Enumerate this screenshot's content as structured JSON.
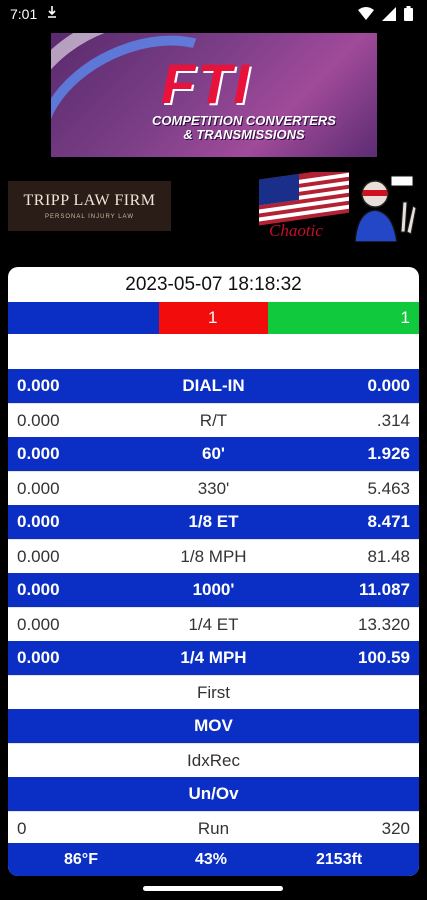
{
  "status_bar": {
    "time": "7:01"
  },
  "sponsors": {
    "fti": {
      "logo_text": "FTI",
      "line1": "COMPETITION CONVERTERS",
      "line2": "& TRANSMISSIONS"
    },
    "tripp": {
      "name": "TRIPP LAW FIRM",
      "sub": "PERSONAL INJURY LAW"
    },
    "chaotic": {
      "script": "Chaotic"
    }
  },
  "timeslip": {
    "timestamp": "2023-05-07 18:18:32",
    "lights": {
      "red_value": "1",
      "green_value": "1"
    },
    "rows": [
      {
        "left": "0.000",
        "label": "DIAL-IN",
        "right": "0.000"
      },
      {
        "left": "0.000",
        "label": "R/T",
        "right": ".314"
      },
      {
        "left": "0.000",
        "label": "60'",
        "right": "1.926"
      },
      {
        "left": "0.000",
        "label": "330'",
        "right": "5.463"
      },
      {
        "left": "0.000",
        "label": "1/8 ET",
        "right": "8.471"
      },
      {
        "left": "0.000",
        "label": "1/8 MPH",
        "right": "81.48"
      },
      {
        "left": "0.000",
        "label": "1000'",
        "right": "11.087"
      },
      {
        "left": "0.000",
        "label": "1/4 ET",
        "right": "13.320"
      },
      {
        "left": "0.000",
        "label": "1/4 MPH",
        "right": "100.59"
      },
      {
        "left": "",
        "label": "First",
        "right": ""
      },
      {
        "left": "",
        "label": "MOV",
        "right": ""
      },
      {
        "left": "",
        "label": "IdxRec",
        "right": ""
      },
      {
        "left": "",
        "label": "Un/Ov",
        "right": ""
      },
      {
        "left": "0",
        "label": "Run",
        "right": "320"
      }
    ],
    "footer": {
      "temperature": "86°F",
      "humidity": "43%",
      "altitude": "2153ft"
    }
  },
  "colors": {
    "blue": "#0b2fc4",
    "red": "#f20c0c",
    "green": "#10c93c"
  }
}
